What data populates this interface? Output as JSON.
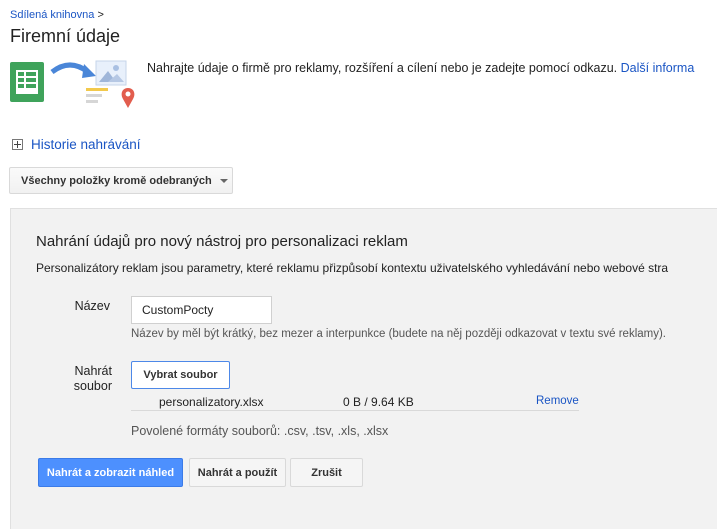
{
  "breadcrumb": {
    "parent": "Sdílená knihovna",
    "separator": ">"
  },
  "page_title": "Firemní údaje",
  "intro": {
    "text": "Nahrajte údaje o firmě pro reklamy, rozšíření a cílení nebo je zadejte pomocí odkazu.",
    "link": "Další informa"
  },
  "history": {
    "label": "Historie nahrávání"
  },
  "filter": {
    "label": "Všechny položky kromě odebraných"
  },
  "panel": {
    "title": "Nahrání údajů pro nový nástroj pro personalizaci reklam",
    "description": "Personalizátory reklam jsou parametry, které reklamu přizpůsobí kontextu uživatelského vyhledávání nebo webové stra",
    "name_label": "Název",
    "name_value": "CustomPocty",
    "name_hint": "Název by měl být krátký, bez mezer a interpunkce (budete na něj později odkazovat v textu své reklamy).",
    "upload_label_line1": "Nahrát",
    "upload_label_line2": "soubor",
    "choose_file": "Vybrat soubor",
    "file": {
      "name": "personalizatory.xlsx",
      "size": "0 B / 9.64 KB",
      "remove": "Remove"
    },
    "formats": "Povolené formáty souborů: .csv, .tsv, .xls, .xlsx"
  },
  "buttons": {
    "upload_preview": "Nahrát a zobrazit náhled",
    "upload_apply": "Nahrát a použít",
    "cancel": "Zrušit"
  },
  "colors": {
    "link": "#1a55c4",
    "primary": "#4d90fe",
    "sheet_green": "#3fa35b"
  },
  "icons": {
    "illustration": "spreadsheet-to-map-illustration",
    "history": "expand-plus-icon",
    "filter": "dropdown-caret-icon"
  }
}
